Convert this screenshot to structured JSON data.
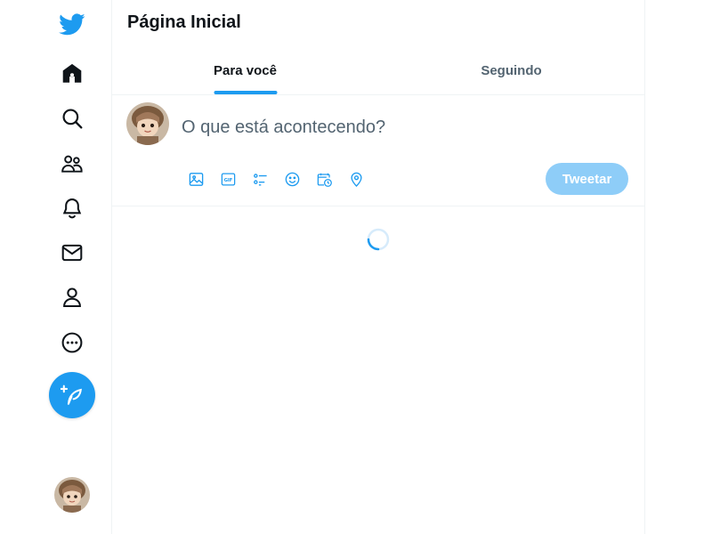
{
  "theme": {
    "accent": "#1d9bf0",
    "accent_muted": "#8ecdf8",
    "text_primary": "#0f1419",
    "text_secondary": "#536471",
    "border": "#eff3f4"
  },
  "nav": {
    "logo_icon": "twitter-bird-icon",
    "items": [
      {
        "id": "home",
        "icon": "home-icon"
      },
      {
        "id": "explore",
        "icon": "search-icon"
      },
      {
        "id": "communities",
        "icon": "communities-icon"
      },
      {
        "id": "notifications",
        "icon": "bell-icon"
      },
      {
        "id": "messages",
        "icon": "envelope-icon"
      },
      {
        "id": "profile",
        "icon": "person-icon"
      },
      {
        "id": "more",
        "icon": "more-circle-icon"
      }
    ],
    "compose_icon": "feather-plus-icon",
    "account_avatar": "user-avatar"
  },
  "header": {
    "title": "Página Inicial"
  },
  "tabs": [
    {
      "label": "Para você",
      "active": true
    },
    {
      "label": "Seguindo",
      "active": false
    }
  ],
  "composer": {
    "placeholder": "O que está acontecendo?",
    "value": "",
    "tools": [
      "image-icon",
      "gif-icon",
      "poll-icon",
      "emoji-icon",
      "schedule-icon",
      "location-icon"
    ],
    "submit_label": "Tweetar",
    "submit_enabled": false
  },
  "feed": {
    "loading": true
  }
}
